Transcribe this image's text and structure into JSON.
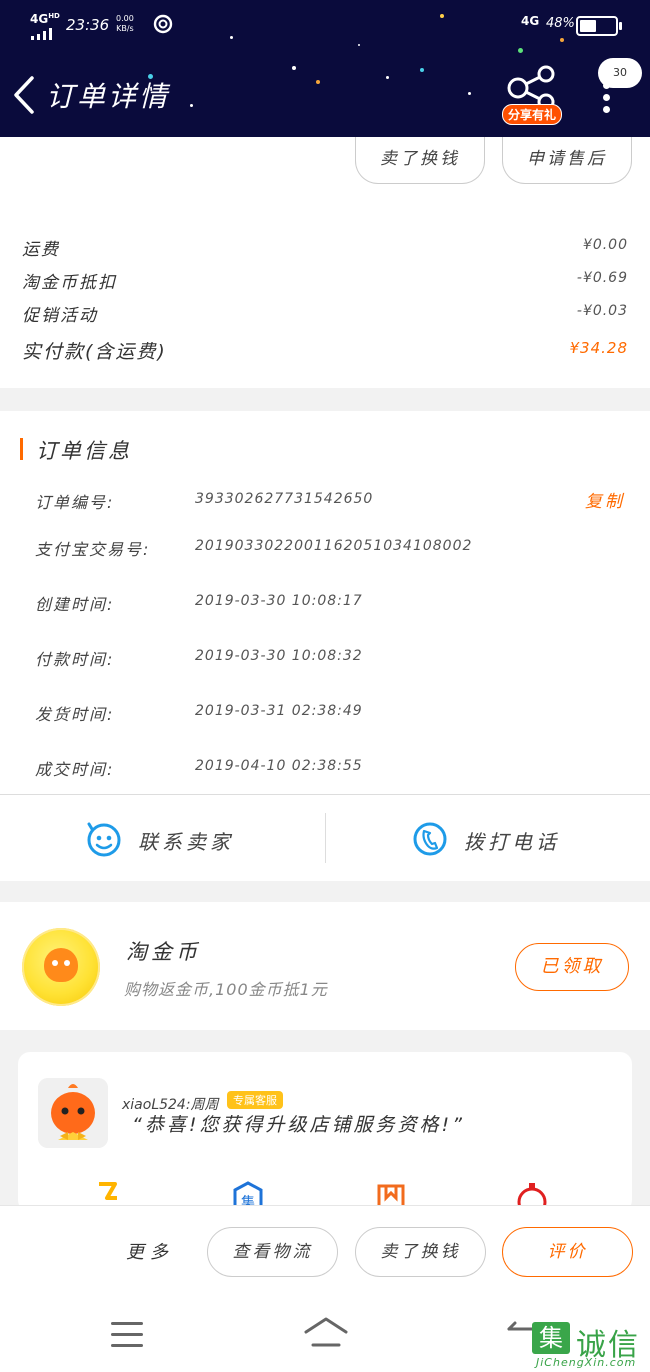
{
  "status_bar": {
    "network_left": "4G",
    "network_left_sup": "HD",
    "time": "23:36",
    "speed_value": "0.00",
    "speed_unit": "KB/s",
    "network_right": "4G",
    "battery": "48%",
    "battery_level": 0.48
  },
  "header": {
    "title": "订单详情",
    "share_label": "分享有礼",
    "message_count": "30"
  },
  "top_actions": {
    "sell_label": "卖了换钱",
    "after_sale_label": "申请售后"
  },
  "fees": [
    {
      "label": "运费",
      "value": "¥0.00"
    },
    {
      "label": "淘金币抵扣",
      "value": "-¥0.69"
    },
    {
      "label": "促销活动",
      "value": "-¥0.03"
    }
  ],
  "total": {
    "label": "实付款(含运费)",
    "value": "¥34.28"
  },
  "order_info": {
    "title": "订单信息",
    "copy_label": "复制",
    "rows": [
      {
        "key": "订单编号:",
        "value": "393302627731542650"
      },
      {
        "key": "支付宝交易号:",
        "value": "2019033022001162051034108002"
      },
      {
        "key": "创建时间:",
        "value": "2019-03-30 10:08:17"
      },
      {
        "key": "付款时间:",
        "value": "2019-03-30 10:08:32"
      },
      {
        "key": "发货时间:",
        "value": "2019-03-31 02:38:49"
      },
      {
        "key": "成交时间:",
        "value": "2019-04-10 02:38:55"
      }
    ],
    "contact_seller": "联系卖家",
    "call_phone": "拨打电话"
  },
  "coin": {
    "title": "淘金币",
    "subtitle": "购物返金币,100金币抵1元",
    "button": "已领取"
  },
  "service": {
    "name": "xiaoL524:周周",
    "badge": "专属客服",
    "message": "“恭喜!您获得升级店铺服务资格!”",
    "icons": [
      "lightning-icon",
      "store-icon",
      "gift-icon",
      "ring-icon"
    ]
  },
  "bottom_bar": {
    "more": "更多",
    "logistics": "查看物流",
    "sell": "卖了换钱",
    "review": "评价"
  },
  "watermark": {
    "logo": "集",
    "text": "诚信",
    "url": "JiChengXin.com"
  },
  "colors": {
    "header_bg": "#0a0b3c",
    "accent": "#ff6a00",
    "icon_blue": "#1e9be8"
  }
}
